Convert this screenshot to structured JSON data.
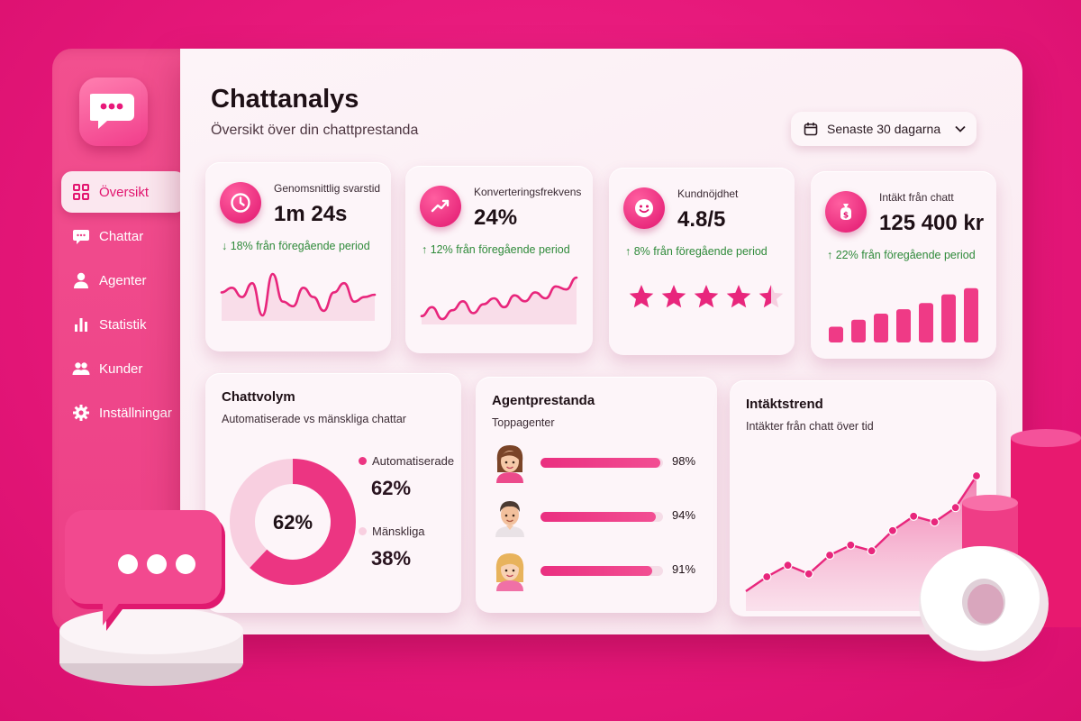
{
  "app": {
    "title": "Chattanalys",
    "subtitle": "Översikt över din chattprestanda"
  },
  "date_filter": {
    "label": "Senaste 30 dagarna",
    "icon": "calendar-icon"
  },
  "sidebar": {
    "items": [
      {
        "label": "Översikt",
        "icon": "grid-icon",
        "active": true
      },
      {
        "label": "Chattar",
        "icon": "chat-icon",
        "active": false
      },
      {
        "label": "Agenter",
        "icon": "user-icon",
        "active": false
      },
      {
        "label": "Statistik",
        "icon": "bar-chart-icon",
        "active": false
      },
      {
        "label": "Kunder",
        "icon": "users-icon",
        "active": false
      },
      {
        "label": "Inställningar",
        "icon": "gear-icon",
        "active": false
      }
    ]
  },
  "kpis": [
    {
      "label": "Genomsnittlig svarstid",
      "value": "1m 24s",
      "trend": "↓ 18% från föregående period",
      "icon": "clock-icon",
      "sparkline": [
        22,
        24,
        20,
        26,
        12,
        30,
        18,
        16,
        24,
        20,
        14,
        22,
        26,
        18,
        20,
        21
      ]
    },
    {
      "label": "Konverteringsfrekvens",
      "value": "24%",
      "trend": "↑ 12% från föregående period",
      "icon": "trend-up-icon",
      "sparkline": [
        12,
        18,
        10,
        16,
        22,
        14,
        20,
        24,
        18,
        26,
        22,
        28,
        24,
        32,
        30,
        38
      ]
    },
    {
      "label": "Kundnöjdhet",
      "value": "4.8/5",
      "trend": "↑ 8% från föregående period",
      "icon": "smile-icon",
      "stars": 4.5
    },
    {
      "label": "Intäkt från chatt",
      "value": "125 400 kr",
      "trend": "↑ 22% från föregående period",
      "icon": "money-bag-icon",
      "bars": [
        18,
        26,
        33,
        38,
        45,
        55,
        62,
        70
      ]
    }
  ],
  "chat_volume": {
    "title": "Chattvolym",
    "subtitle": "Automatiserade vs mänskliga chattar",
    "center_label": "62%",
    "segments": [
      {
        "label": "Automatiserade",
        "value": "62%",
        "fraction": 0.62,
        "color": "#ec3582"
      },
      {
        "label": "Mänskliga",
        "value": "38%",
        "fraction": 0.38,
        "color": "#f8cfe0"
      }
    ]
  },
  "agents": {
    "title": "Agentprestanda",
    "subtitle": "Toppagenter",
    "rows": [
      {
        "value": "98%",
        "fraction": 0.98,
        "avatar": "female-brown-hair-avatar"
      },
      {
        "value": "94%",
        "fraction": 0.94,
        "avatar": "male-dark-hair-avatar"
      },
      {
        "value": "91%",
        "fraction": 0.91,
        "avatar": "female-blonde-hair-avatar"
      }
    ]
  },
  "revenue_trend": {
    "title": "Intäktstrend",
    "subtitle": "Intäkter från chatt över tid"
  },
  "chart_data": {
    "type": "area",
    "title": "Intäktstrend",
    "subtitle": "Intäkter från chatt över tid",
    "x": [
      1,
      2,
      3,
      4,
      5,
      6,
      7,
      8,
      9,
      10,
      11,
      12
    ],
    "y": [
      10,
      20,
      28,
      22,
      35,
      42,
      38,
      52,
      62,
      58,
      68,
      90
    ],
    "xlabel": "",
    "ylabel": "",
    "grid": false
  }
}
